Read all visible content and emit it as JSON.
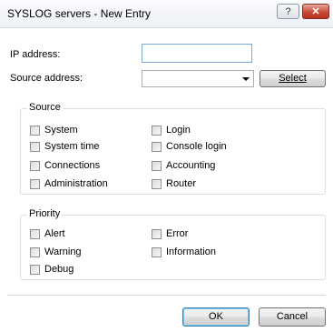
{
  "window": {
    "title": "SYSLOG servers - New Entry",
    "help_glyph": "?",
    "close_glyph": "✕"
  },
  "form": {
    "ip_address_label": "IP address:",
    "ip_address_value": "",
    "source_address_label": "Source address:",
    "source_address_value": "",
    "select_label": "Select"
  },
  "source_group": {
    "title": "Source",
    "items": [
      {
        "label": "System",
        "checked": false
      },
      {
        "label": "Login",
        "checked": false
      },
      {
        "label": "System time",
        "checked": false
      },
      {
        "label": "Console login",
        "checked": false
      },
      {
        "label": "Connections",
        "checked": false
      },
      {
        "label": "Accounting",
        "checked": false
      },
      {
        "label": "Administration",
        "checked": false
      },
      {
        "label": "Router",
        "checked": false
      }
    ]
  },
  "priority_group": {
    "title": "Priority",
    "items": [
      {
        "label": "Alert",
        "checked": false
      },
      {
        "label": "Error",
        "checked": false
      },
      {
        "label": "Warning",
        "checked": false
      },
      {
        "label": "Information",
        "checked": false
      },
      {
        "label": "Debug",
        "checked": false
      }
    ]
  },
  "buttons": {
    "ok_label": "OK",
    "cancel_label": "Cancel"
  }
}
